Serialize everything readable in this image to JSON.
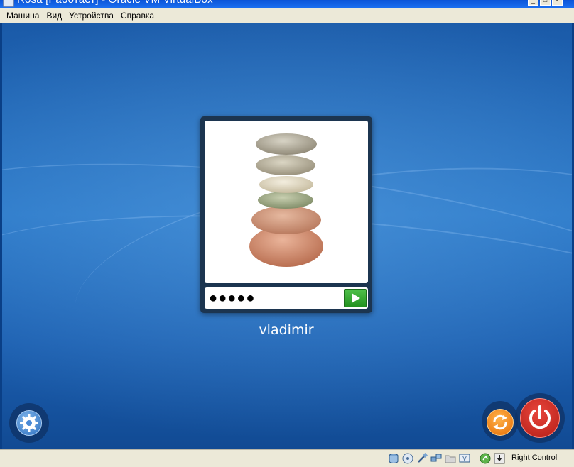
{
  "window": {
    "title": "Rosa [Работает] - Oracle VM VirtualBox",
    "controls": [
      "_",
      "□",
      "×"
    ]
  },
  "menubar": {
    "items": [
      "Машина",
      "Вид",
      "Устройства",
      "Справка"
    ]
  },
  "login": {
    "username": "vladimir",
    "password_mask": "●●●●●"
  },
  "statusbar": {
    "host_key": "Right Control",
    "icons": [
      "hard-disk-icon",
      "optical-drive-icon",
      "usb-icon",
      "network-icon",
      "shared-folders-icon",
      "display-icon",
      "mouse-integration-icon",
      "host-key-arrow-icon"
    ]
  },
  "colors": {
    "titlebar": "#0b55d8",
    "desktop": "#2a78c8",
    "submit": "#23921f",
    "refresh": "#e56d05",
    "power": "#b41d16"
  }
}
